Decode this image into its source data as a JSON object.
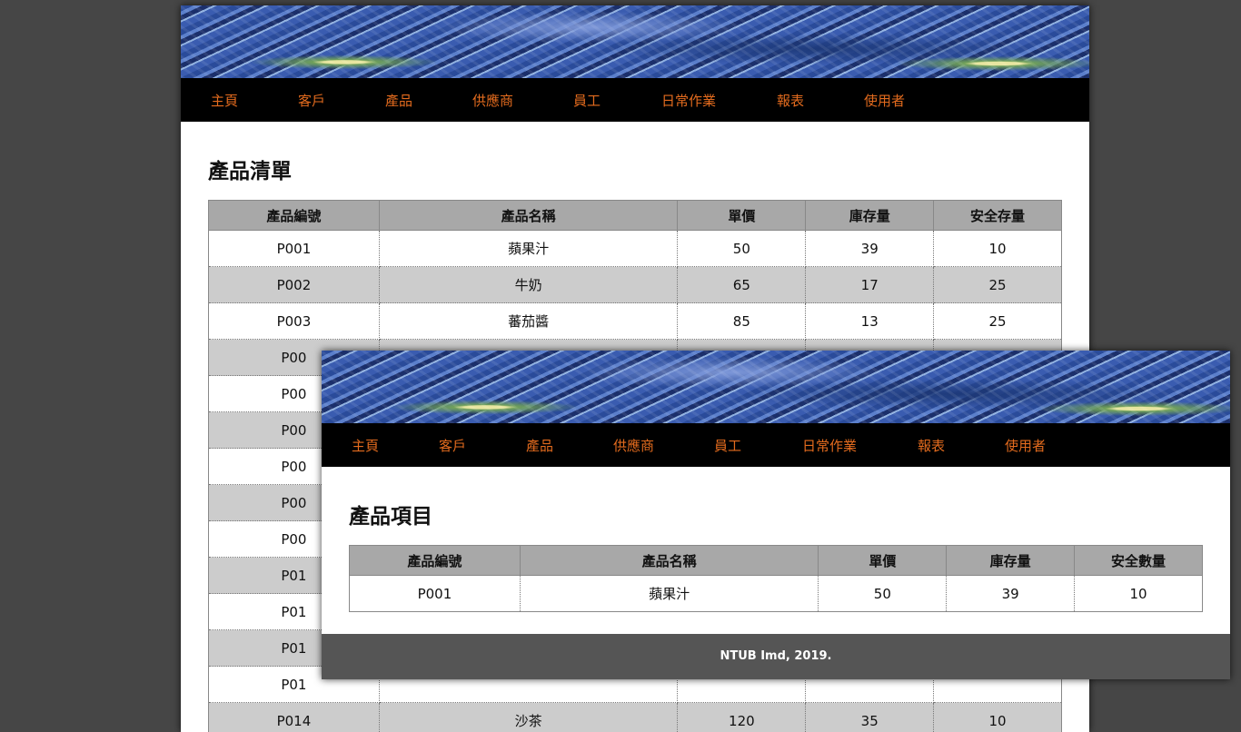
{
  "nav": [
    "主頁",
    "客戶",
    "產品",
    "供應商",
    "員工",
    "日常作業",
    "報表",
    "使用者"
  ],
  "back_window": {
    "title": "產品清單",
    "columns": [
      "產品編號",
      "產品名稱",
      "單價",
      "庫存量",
      "安全存量"
    ],
    "rows": [
      [
        "P001",
        "蘋果汁",
        "50",
        "39",
        "10"
      ],
      [
        "P002",
        "牛奶",
        "65",
        "17",
        "25"
      ],
      [
        "P003",
        "蕃茄醬",
        "85",
        "13",
        "25"
      ],
      [
        "P00",
        "",
        "",
        "",
        ""
      ],
      [
        "P00",
        "",
        "",
        "",
        ""
      ],
      [
        "P00",
        "",
        "",
        "",
        ""
      ],
      [
        "P00",
        "",
        "",
        "",
        ""
      ],
      [
        "P00",
        "",
        "",
        "",
        ""
      ],
      [
        "P00",
        "",
        "",
        "",
        ""
      ],
      [
        "P01",
        "",
        "",
        "",
        ""
      ],
      [
        "P01",
        "",
        "",
        "",
        ""
      ],
      [
        "P01",
        "",
        "",
        "",
        ""
      ],
      [
        "P01",
        "",
        "",
        "",
        ""
      ],
      [
        "P014",
        "沙茶",
        "120",
        "35",
        "10"
      ]
    ]
  },
  "front_window": {
    "title": "產品項目",
    "columns": [
      "產品編號",
      "產品名稱",
      "單價",
      "庫存量",
      "安全數量"
    ],
    "rows": [
      [
        "P001",
        "蘋果汁",
        "50",
        "39",
        "10"
      ]
    ],
    "footer": "NTUB Imd, 2019."
  },
  "colors": {
    "nav_text": "#e36b1e",
    "nav_bg": "#000000",
    "header_bg": "#a8a8a8",
    "alt_row_bg": "#cccccc",
    "footer_bg": "#555555",
    "desktop_bg": "#464646"
  }
}
